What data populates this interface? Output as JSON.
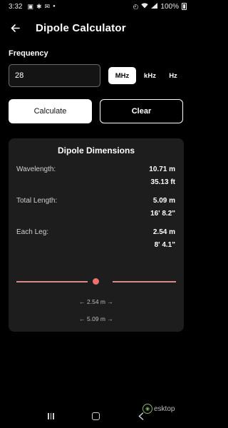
{
  "status_bar": {
    "time": "3:32",
    "battery": "100%",
    "left_icons": [
      "gallery-icon",
      "settings-icon",
      "mail-icon",
      "dot-icon"
    ],
    "right_icons": [
      "alarm-icon",
      "wifi-icon",
      "signal-icon",
      "battery-icon"
    ]
  },
  "header": {
    "title": "Dipole Calculator",
    "back_icon": "arrow-left-icon"
  },
  "frequency": {
    "label": "Frequency",
    "value": "28",
    "units": [
      "MHz",
      "kHz",
      "Hz"
    ],
    "selected_unit": "MHz"
  },
  "actions": {
    "calculate_label": "Calculate",
    "clear_label": "Clear"
  },
  "results": {
    "title": "Dipole Dimensions",
    "rows": [
      {
        "label": "Wavelength:",
        "metric": "10.71 m",
        "imperial": "35.13 ft"
      },
      {
        "label": "Total Length:",
        "metric": "5.09 m",
        "imperial": "16' 8.2\""
      },
      {
        "label": "Each Leg:",
        "metric": "2.54 m",
        "imperial": "8' 4.1\""
      }
    ],
    "leg_dimension": "← 2.54 m →",
    "total_dimension": "← 5.09 m →"
  },
  "colors": {
    "background": "#000000",
    "card": "#1d1d1d",
    "dipole_wire": "#d98a8a",
    "feed_point": "#ef7070"
  },
  "watermark": "esktop"
}
